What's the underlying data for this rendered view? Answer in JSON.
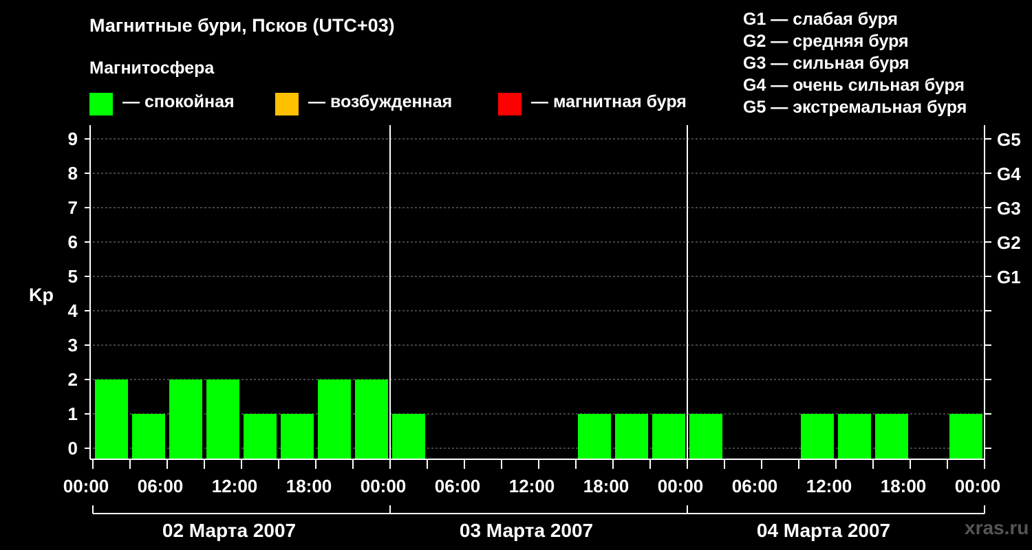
{
  "header": {
    "title": "Магнитные бури, Псков (UTC+03)",
    "magnetosphere_label": "Магнитосфера"
  },
  "legend": {
    "items": [
      {
        "label": "— спокойная",
        "color": "#00ff00"
      },
      {
        "label": "— возбужденная",
        "color": "#ffc000"
      },
      {
        "label": "— магнитная буря",
        "color": "#ff0000"
      }
    ],
    "storm_levels": [
      "G1 — слабая буря",
      "G2 — средняя буря",
      "G3 — сильная буря",
      "G4 — очень сильная буря",
      "G5 — экстремальная буря"
    ]
  },
  "watermark": "xras.ru",
  "chart_data": {
    "type": "bar",
    "ylabel": "Kp",
    "ylim": [
      0,
      9
    ],
    "y_ticks": [
      "0",
      "1",
      "2",
      "3",
      "4",
      "5",
      "6",
      "7",
      "8",
      "9"
    ],
    "right_axis": [
      {
        "kp": 5,
        "label": "G1"
      },
      {
        "kp": 6,
        "label": "G2"
      },
      {
        "kp": 7,
        "label": "G3"
      },
      {
        "kp": 8,
        "label": "G4"
      },
      {
        "kp": 9,
        "label": "G5"
      }
    ],
    "x_tick_labels": [
      "00:00",
      "06:00",
      "12:00",
      "18:00",
      "00:00",
      "06:00",
      "12:00",
      "18:00",
      "00:00",
      "06:00",
      "12:00",
      "18:00",
      "00:00"
    ],
    "interval_hours": 3,
    "days": [
      {
        "label": "02 Марта 2007",
        "values": [
          2,
          1,
          2,
          2,
          1,
          1,
          2,
          2
        ]
      },
      {
        "label": "03 Марта 2007",
        "values": [
          1,
          0,
          0,
          0,
          0,
          1,
          1,
          1
        ]
      },
      {
        "label": "04 Марта 2007",
        "values": [
          1,
          0,
          0,
          1,
          1,
          1,
          0,
          1
        ]
      }
    ],
    "bar_color": "#00ff00",
    "grid": true
  }
}
